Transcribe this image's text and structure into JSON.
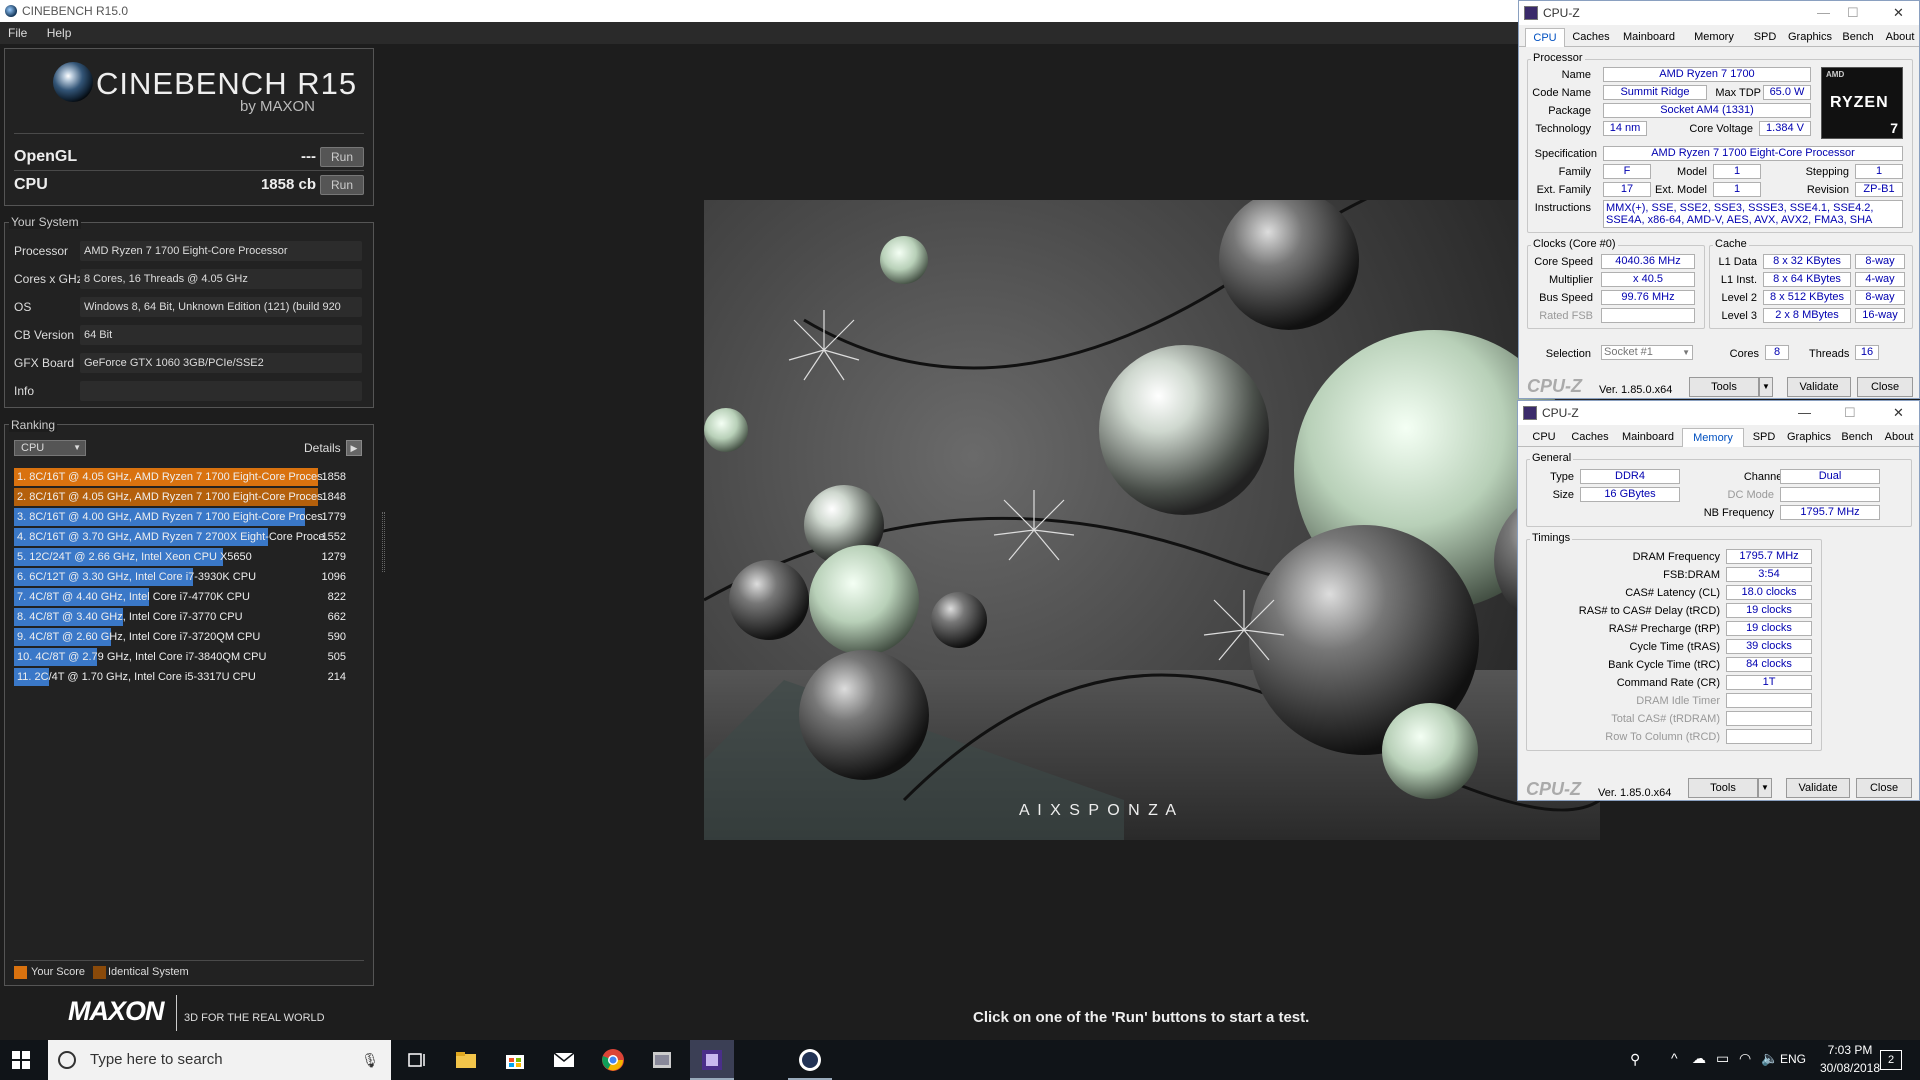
{
  "cinebench": {
    "title": "CINEBENCH R15.0",
    "menu": [
      "File",
      "Help"
    ],
    "logo": {
      "name": "CINEBENCH R15",
      "sub": "by MAXON"
    },
    "opengl": {
      "label": "OpenGL",
      "value": "---",
      "run": "Run"
    },
    "cpu": {
      "label": "CPU",
      "value": "1858 cb",
      "run": "Run"
    },
    "your_system": {
      "title": "Your System",
      "rows": [
        {
          "label": "Processor",
          "value": "AMD Ryzen 7 1700 Eight-Core Processor"
        },
        {
          "label": "Cores x GHz",
          "value": "8 Cores, 16 Threads @ 4.05 GHz"
        },
        {
          "label": "OS",
          "value": "Windows 8, 64 Bit, Unknown Edition (121) (build 920"
        },
        {
          "label": "CB Version",
          "value": "64 Bit"
        },
        {
          "label": "GFX Board",
          "value": "GeForce GTX 1060 3GB/PCIe/SSE2"
        },
        {
          "label": "Info",
          "value": ""
        }
      ]
    },
    "ranking": {
      "title": "Ranking",
      "select": "CPU",
      "details": "Details",
      "rows": [
        {
          "text": "1. 8C/16T @ 4.05 GHz, AMD Ryzen 7 1700 Eight-Core Proces",
          "score": "1858",
          "fraction": 1.0,
          "color": "#d9720f"
        },
        {
          "text": "2. 8C/16T @ 4.05 GHz, AMD Ryzen 7 1700 Eight-Core Proces",
          "score": "1848",
          "fraction": 1.0,
          "color": "#b4600c"
        },
        {
          "text": "3. 8C/16T @ 4.00 GHz, AMD Ryzen 7 1700 Eight-Core Proces",
          "score": "1779",
          "fraction": 0.958,
          "color": "#3a78c8"
        },
        {
          "text": "4. 8C/16T @ 3.70 GHz, AMD Ryzen 7 2700X Eight-Core Proce",
          "score": "1552",
          "fraction": 0.836,
          "color": "#3a78c8"
        },
        {
          "text": "5. 12C/24T @ 2.66 GHz, Intel Xeon CPU X5650",
          "score": "1279",
          "fraction": 0.689,
          "color": "#3a78c8"
        },
        {
          "text": "6. 6C/12T @ 3.30 GHz,  Intel Core i7-3930K CPU",
          "score": "1096",
          "fraction": 0.59,
          "color": "#3a78c8"
        },
        {
          "text": "7. 4C/8T @ 4.40 GHz, Intel Core i7-4770K CPU",
          "score": "822",
          "fraction": 0.443,
          "color": "#3a78c8"
        },
        {
          "text": "8. 4C/8T @ 3.40 GHz,  Intel Core i7-3770 CPU",
          "score": "662",
          "fraction": 0.357,
          "color": "#3a78c8"
        },
        {
          "text": "9. 4C/8T @ 2.60 GHz,  Intel Core i7-3720QM CPU",
          "score": "590",
          "fraction": 0.318,
          "color": "#3a78c8"
        },
        {
          "text": "10. 4C/8T @ 2.79 GHz,  Intel Core i7-3840QM CPU",
          "score": "505",
          "fraction": 0.272,
          "color": "#3a78c8"
        },
        {
          "text": "11. 2C/4T @ 1.70 GHz,  Intel Core i5-3317U CPU",
          "score": "214",
          "fraction": 0.115,
          "color": "#3a78c8"
        }
      ],
      "legend": {
        "your_score": "Your Score",
        "identical": "Identical System",
        "your_color": "#d9720f",
        "identical_color": "#8a4a0a"
      }
    },
    "footer": {
      "brand": "MAXON",
      "tagline": "3D FOR THE REAL WORLD",
      "hint": "Click on one of the 'Run' buttons to start a test."
    },
    "render_credit": "A I X S P O N Z A"
  },
  "cpuz1": {
    "title": "CPU-Z",
    "tabs": [
      "CPU",
      "Caches",
      "Mainboard",
      "Memory",
      "SPD",
      "Graphics",
      "Bench",
      "About"
    ],
    "active_tab": "CPU",
    "processor": {
      "group": "Processor",
      "name_l": "Name",
      "name": "AMD Ryzen 7 1700",
      "code_l": "Code Name",
      "code": "Summit Ridge",
      "tdp_l": "Max TDP",
      "tdp": "65.0 W",
      "pkg_l": "Package",
      "pkg": "Socket AM4 (1331)",
      "tech_l": "Technology",
      "tech": "14 nm",
      "volt_l": "Core Voltage",
      "volt": "1.384 V",
      "spec_l": "Specification",
      "spec": "AMD Ryzen 7 1700 Eight-Core Processor",
      "fam_l": "Family",
      "fam": "F",
      "model_l": "Model",
      "model": "1",
      "step_l": "Stepping",
      "step": "1",
      "efam_l": "Ext. Family",
      "efam": "17",
      "emodel_l": "Ext. Model",
      "emodel": "1",
      "rev_l": "Revision",
      "rev": "ZP-B1",
      "instr_l": "Instructions",
      "instr": "MMX(+), SSE, SSE2, SSE3, SSSE3, SSE4.1, SSE4.2, SSE4A, x86-64, AMD-V, AES, AVX, AVX2, FMA3, SHA",
      "badge_top": "AMD",
      "badge": "RYZEN",
      "badge_num": "7"
    },
    "clocks": {
      "group": "Clocks (Core #0)",
      "speed_l": "Core Speed",
      "speed": "4040.36 MHz",
      "mult_l": "Multiplier",
      "mult": "x 40.5",
      "bus_l": "Bus Speed",
      "bus": "99.76 MHz",
      "fsb_l": "Rated FSB",
      "fsb": ""
    },
    "cache": {
      "group": "Cache",
      "rows": [
        {
          "l": "L1 Data",
          "v": "8 x 32 KBytes",
          "w": "8-way"
        },
        {
          "l": "L1 Inst.",
          "v": "8 x 64 KBytes",
          "w": "4-way"
        },
        {
          "l": "Level 2",
          "v": "8 x 512 KBytes",
          "w": "8-way"
        },
        {
          "l": "Level 3",
          "v": "2 x 8 MBytes",
          "w": "16-way"
        }
      ]
    },
    "selection": {
      "l": "Selection",
      "v": "Socket #1",
      "cores_l": "Cores",
      "cores": "8",
      "threads_l": "Threads",
      "threads": "16"
    },
    "footer": {
      "logo": "CPU-Z",
      "ver": "Ver. 1.85.0.x64",
      "tools": "Tools",
      "validate": "Validate",
      "close": "Close"
    }
  },
  "cpuz2": {
    "title": "CPU-Z",
    "tabs": [
      "CPU",
      "Caches",
      "Mainboard",
      "Memory",
      "SPD",
      "Graphics",
      "Bench",
      "About"
    ],
    "active_tab": "Memory",
    "general": {
      "group": "General",
      "type_l": "Type",
      "type": "DDR4",
      "size_l": "Size",
      "size": "16 GBytes",
      "chan_l": "Channel #",
      "chan": "Dual",
      "dc_l": "DC Mode",
      "dc": "",
      "nb_l": "NB Frequency",
      "nb": "1795.7 MHz"
    },
    "timings": {
      "group": "Timings",
      "rows": [
        {
          "l": "DRAM Frequency",
          "v": "1795.7 MHz",
          "dim": false
        },
        {
          "l": "FSB:DRAM",
          "v": "3:54",
          "dim": false
        },
        {
          "l": "CAS# Latency (CL)",
          "v": "18.0 clocks",
          "dim": false
        },
        {
          "l": "RAS# to CAS# Delay (tRCD)",
          "v": "19 clocks",
          "dim": false
        },
        {
          "l": "RAS# Precharge (tRP)",
          "v": "19 clocks",
          "dim": false
        },
        {
          "l": "Cycle Time (tRAS)",
          "v": "39 clocks",
          "dim": false
        },
        {
          "l": "Bank Cycle Time (tRC)",
          "v": "84 clocks",
          "dim": false
        },
        {
          "l": "Command Rate (CR)",
          "v": "1T",
          "dim": false
        },
        {
          "l": "DRAM Idle Timer",
          "v": "",
          "dim": true
        },
        {
          "l": "Total CAS# (tRDRAM)",
          "v": "",
          "dim": true
        },
        {
          "l": "Row To Column (tRCD)",
          "v": "",
          "dim": true
        }
      ]
    },
    "footer": {
      "logo": "CPU-Z",
      "ver": "Ver. 1.85.0.x64",
      "tools": "Tools",
      "validate": "Validate",
      "close": "Close"
    }
  },
  "taskbar": {
    "search": "Type here to search",
    "lang": "ENG",
    "time": "7:03 PM",
    "date": "30/08/2018",
    "notif_count": "2"
  }
}
